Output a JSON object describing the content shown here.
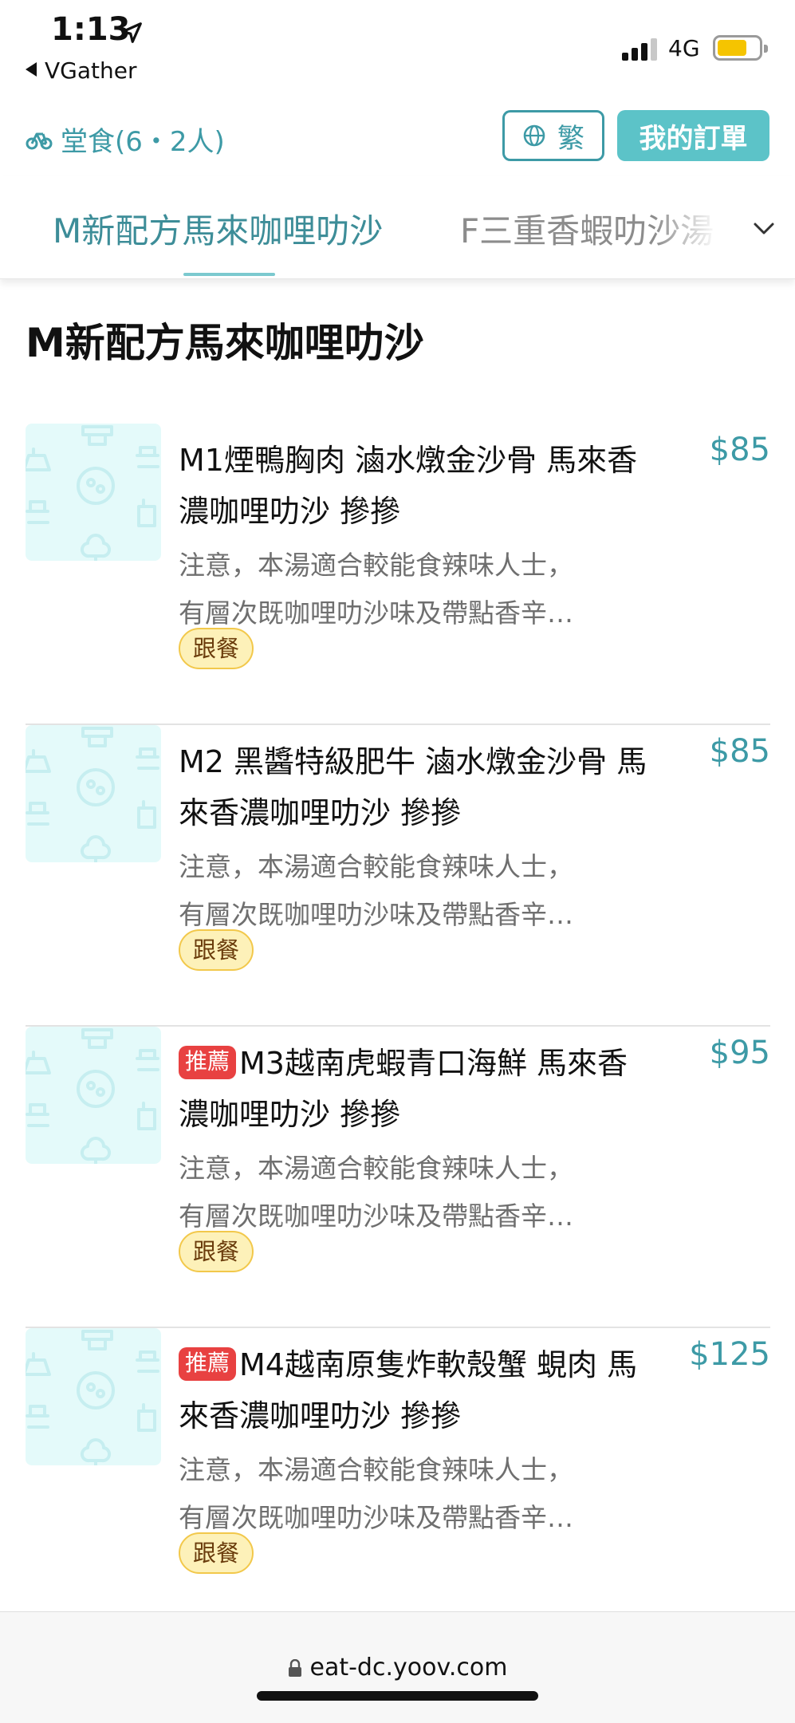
{
  "status_bar": {
    "time": "1:13",
    "back_app": "VGather",
    "network": "4G",
    "battery_level": 0.72
  },
  "header": {
    "dine_info": "堂食(6・2人)",
    "lang_label": "繁",
    "orders_label": "我的訂單"
  },
  "categories": {
    "tabs": [
      "M新配方馬來咖哩叻沙",
      "F三重香蝦叻沙湯"
    ],
    "active_index": 0
  },
  "section": {
    "title": "M新配方馬來咖哩叻沙"
  },
  "menu_items": [
    {
      "badge": "",
      "name": "M1煙鴨胸肉 滷水燉金沙骨 馬來香濃咖哩叻沙 摻摻",
      "desc_line1": "注意，本湯適合較能食辣味人士，",
      "desc_line2": "有層次既咖哩叻沙味及帶點香辛…",
      "tag": "跟餐",
      "price": "$85"
    },
    {
      "badge": "",
      "name": "M2 黑醬特級肥牛 滷水燉金沙骨 馬來香濃咖哩叻沙 摻摻",
      "desc_line1": "注意，本湯適合較能食辣味人士，",
      "desc_line2": "有層次既咖哩叻沙味及帶點香辛…",
      "tag": "跟餐",
      "price": "$85"
    },
    {
      "badge": "推薦",
      "name": "M3越南虎蝦青口海鮮 馬來香濃咖哩叻沙 摻摻",
      "desc_line1": "注意，本湯適合較能食辣味人士，",
      "desc_line2": "有層次既咖哩叻沙味及帶點香辛…",
      "tag": "跟餐",
      "price": "$95"
    },
    {
      "badge": "推薦",
      "name": "M4越南原隻炸軟殼蟹 蜆肉 馬來香濃咖哩叻沙 摻摻",
      "desc_line1": "注意，本湯適合較能食辣味人士，",
      "desc_line2": "有層次既咖哩叻沙味及帶點香辛…",
      "tag": "跟餐",
      "price": "$125"
    }
  ],
  "url_bar": {
    "url": "eat-dc.yoov.com"
  },
  "colors": {
    "accent": "#3d9aa6",
    "orders_button": "#5cc3c8",
    "recommend_badge": "#e84141",
    "set_badge_bg": "#fdf1b9"
  }
}
